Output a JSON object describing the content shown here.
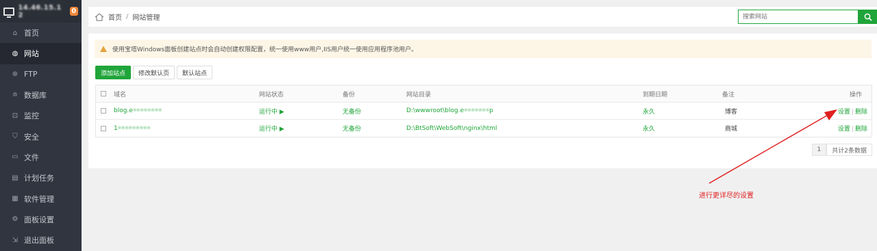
{
  "sidebar": {
    "server_ip": "1​4​.​4​6.​1​5.​1​2​",
    "badge_count": "0",
    "items": [
      {
        "label": "首页",
        "icon": "home-icon"
      },
      {
        "label": "网站",
        "icon": "globe-icon"
      },
      {
        "label": "FTP",
        "icon": "ftp-icon"
      },
      {
        "label": "数据库",
        "icon": "database-icon"
      },
      {
        "label": "监控",
        "icon": "monitor-icon"
      },
      {
        "label": "安全",
        "icon": "shield-icon"
      },
      {
        "label": "文件",
        "icon": "folder-icon"
      },
      {
        "label": "计划任务",
        "icon": "calendar-icon"
      },
      {
        "label": "软件管理",
        "icon": "grid-icon"
      },
      {
        "label": "面板设置",
        "icon": "gear-icon"
      },
      {
        "label": "退出面板",
        "icon": "logout-icon"
      }
    ],
    "active_index": 1
  },
  "header": {
    "breadcrumb_home": "首页",
    "breadcrumb_sep": "/",
    "breadcrumb_current": "网站管理",
    "search_placeholder": "搜索网站"
  },
  "notice": "使用宝塔Windows面板创建站点时会自动创建权限配置，统一使用www用户,IIS用户统一使用应用程序池用户。",
  "toolbar": {
    "add_site": "添加站点",
    "edit_default_page": "修改默认页",
    "default_site": "默认站点"
  },
  "table": {
    "headers": {
      "domain": "域名",
      "status": "网站状态",
      "backup": "备份",
      "root": "网站目录",
      "expire": "到期日期",
      "note": "备注",
      "ops": "操作"
    },
    "rows": [
      {
        "domain": "blog.e••••••••",
        "status": "运行中 ▶",
        "backup": "无备份",
        "root": "D:\\wwwroot\\blog.e•••••••p",
        "expire": "永久",
        "note": "博客",
        "op_settings": "设置",
        "op_delete": "删除"
      },
      {
        "domain": "1•••••••••",
        "status": "运行中 ▶",
        "backup": "无备份",
        "root": "D:\\BtSoft\\WebSoft\\nginx\\html",
        "expire": "永久",
        "note": "商城",
        "op_settings": "设置",
        "op_delete": "删除"
      }
    ]
  },
  "pagination": {
    "page": "1",
    "total": "共计2条数据"
  },
  "annotation": {
    "text": "进行更详尽的设置",
    "color": "#e02020"
  },
  "colors": {
    "accent": "#20a53a",
    "sidebar_bg": "#313540",
    "badge": "#f0883a"
  }
}
